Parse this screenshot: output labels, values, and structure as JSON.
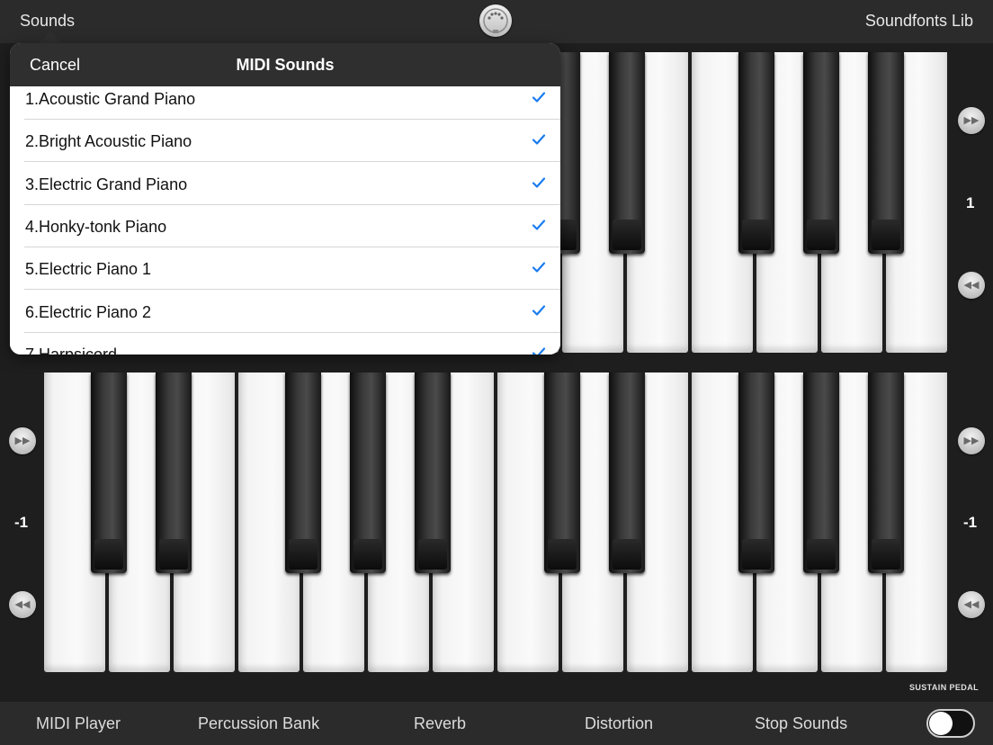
{
  "topbar": {
    "left_link": "Sounds",
    "center_icon": "midi-connector-icon",
    "right_link": "Soundfonts Lib"
  },
  "popover": {
    "title": "MIDI Sounds",
    "cancel_label": "Cancel",
    "items": [
      {
        "label": "1.Acoustic Grand Piano",
        "checked": true
      },
      {
        "label": "2.Bright Acoustic Piano",
        "checked": true
      },
      {
        "label": "3.Electric Grand Piano",
        "checked": true
      },
      {
        "label": "4.Honky-tonk Piano",
        "checked": true
      },
      {
        "label": "5.Electric Piano 1",
        "checked": true
      },
      {
        "label": "6.Electric Piano 2",
        "checked": true
      },
      {
        "label": "7.Harpsicord",
        "checked": true
      }
    ],
    "check_color": "#1a7cf0"
  },
  "keyboards": {
    "top": {
      "octave_right": "1"
    },
    "bottom": {
      "octave_left": "-1",
      "octave_right": "-1"
    }
  },
  "octave_buttons": {
    "up_icon": "fast-forward-icon",
    "down_icon": "rewind-icon"
  },
  "sustain": {
    "label": "SUSTAIN PEDAL",
    "enabled": false
  },
  "bottombar": {
    "midi_player": "MIDI Player",
    "percussion_bank": "Percussion Bank",
    "reverb": "Reverb",
    "distortion": "Distortion",
    "stop_sounds": "Stop Sounds"
  }
}
